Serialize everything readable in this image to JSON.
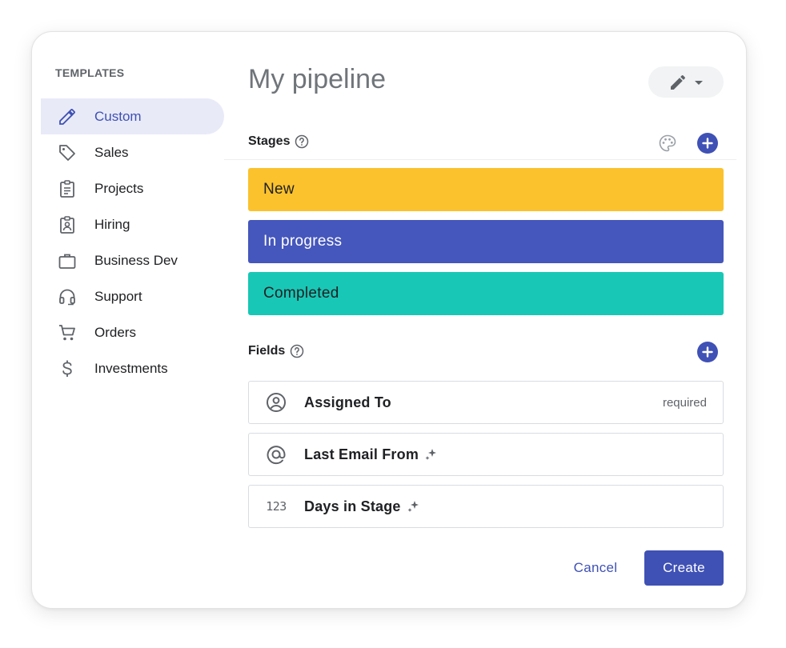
{
  "sidebar": {
    "heading": "TEMPLATES",
    "items": [
      {
        "label": "Custom",
        "icon": "pencil-icon",
        "active": true
      },
      {
        "label": "Sales",
        "icon": "tag-icon"
      },
      {
        "label": "Projects",
        "icon": "clipboard-icon"
      },
      {
        "label": "Hiring",
        "icon": "badge-icon"
      },
      {
        "label": "Business Dev",
        "icon": "briefcase-icon"
      },
      {
        "label": "Support",
        "icon": "headset-icon"
      },
      {
        "label": "Orders",
        "icon": "cart-icon"
      },
      {
        "label": "Investments",
        "icon": "dollar-icon"
      }
    ]
  },
  "main": {
    "title": "My pipeline",
    "stages": {
      "label": "Stages",
      "items": [
        {
          "label": "New",
          "color": "#fbc22e",
          "text_color": "#202124"
        },
        {
          "label": "In progress",
          "color": "#4556bc",
          "text_color": "#ffffff"
        },
        {
          "label": "Completed",
          "color": "#19c7b6",
          "text_color": "#202124"
        }
      ]
    },
    "fields": {
      "label": "Fields",
      "items": [
        {
          "label": "Assigned To",
          "icon": "person-circle-icon",
          "meta": "required",
          "sparkle": false
        },
        {
          "label": "Last Email From",
          "icon": "at-sign-icon",
          "meta": "",
          "sparkle": true
        },
        {
          "label": "Days in Stage",
          "icon": "numeric-icon",
          "icon_text": "123",
          "meta": "",
          "sparkle": true
        }
      ]
    }
  },
  "footer": {
    "cancel_label": "Cancel",
    "create_label": "Create"
  },
  "colors": {
    "accent": "#3f51b5",
    "active_bg": "#e8eaf8"
  }
}
